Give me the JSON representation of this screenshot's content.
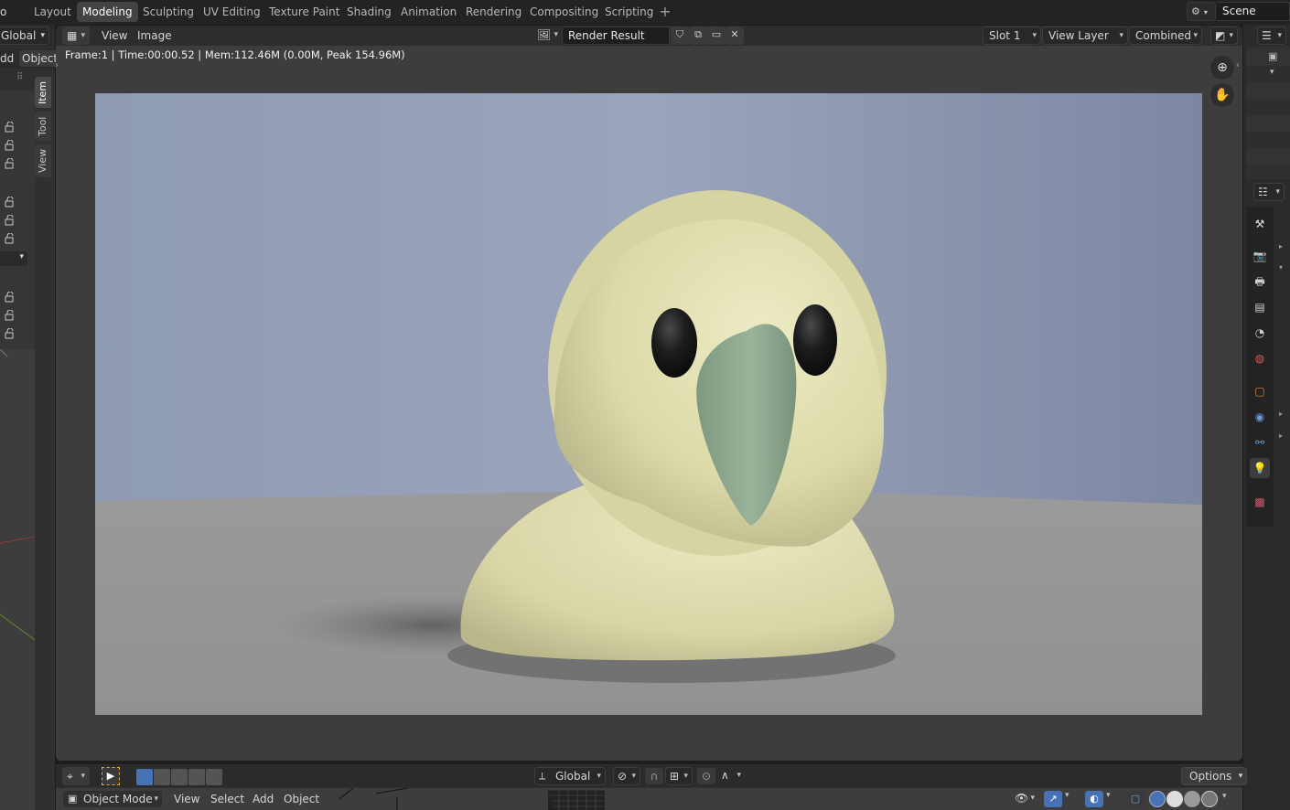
{
  "workspace_tabs": [
    "Layout",
    "Modeling",
    "Sculpting",
    "UV Editing",
    "Texture Paint",
    "Shading",
    "Animation",
    "Rendering",
    "Compositing",
    "Scripting"
  ],
  "active_workspace": "Modeling",
  "top_left_fragment": "o",
  "scene": {
    "label": "Scene"
  },
  "left_panel": {
    "orientation": "Global",
    "menu_fragment_add": "dd",
    "menu_fragment_object": "Object",
    "sidebar_tabs": [
      "Item",
      "Tool",
      "View"
    ],
    "active_sidebar_tab": "Item"
  },
  "image_editor": {
    "menus": [
      "View",
      "Image"
    ],
    "image_name": "Render Result",
    "slot": "Slot 1",
    "view_layer": "View Layer",
    "pass": "Combined",
    "frame_info": "Frame:1 | Time:00:00.52 | Mem:112.46M (0.00M, Peak 154.96M)"
  },
  "render": {
    "wall_color": "#8a95b0",
    "floor_color": "#9a9a9a",
    "body_color": "#e2e0b0",
    "beak_color": "#8ea68e",
    "eye_color": "#1a1a1a"
  },
  "bottom_bar": {
    "orientation": "Global",
    "mode": "Object Mode",
    "menus": [
      "View",
      "Select",
      "Add",
      "Object"
    ],
    "options_label": "Options"
  },
  "icons": {
    "editor_type": "image-editor-icon",
    "zoom": "zoom-icon",
    "pan": "hand-pan-icon"
  }
}
